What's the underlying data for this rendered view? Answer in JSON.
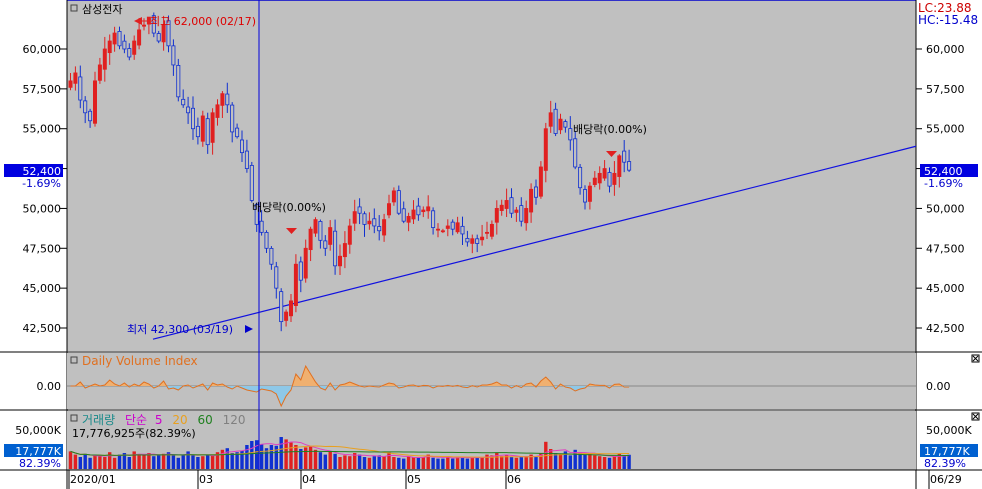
{
  "stock_name": "삼성전자",
  "indicators": {
    "lc": "LC:23.88",
    "hc": "HC:-15.48"
  },
  "current": {
    "price": "52,400",
    "change": "-1.69%"
  },
  "annotations": {
    "high": "최고 62,000 (02/17)",
    "low": "최저 42,300 (03/19)",
    "dividend1": "배당락(0.00%)",
    "dividend2": "배당락(0.00%)"
  },
  "volume_index_panel": {
    "title": "Daily Volume Index",
    "zero_left": "0.00",
    "zero_right": "0.00"
  },
  "volume_panel": {
    "title": "거래량",
    "ma_label": "단순",
    "ma_periods": [
      "5",
      "20",
      "60",
      "120"
    ],
    "ma_colors": [
      "#e040c0",
      "#e8a020",
      "#208020",
      "#808080"
    ],
    "last_volume": "17,776,925주(82.39%)",
    "axis_label": "50,000K",
    "value": "17,777K",
    "percent": "82.39%"
  },
  "x_axis_labels": [
    "2020/01",
    "03",
    "04",
    "05",
    "06",
    "06/29"
  ],
  "colors": {
    "up": "#e02020",
    "down": "#1030d0",
    "panel_bg": "#c0c0c0",
    "trendline": "#1010e0",
    "price_badge": "#0000e0"
  },
  "chart_data": {
    "type": "candlestick",
    "title": "삼성전자",
    "y_ticks": [
      42500,
      45000,
      47500,
      50000,
      52500,
      55000,
      57500,
      60000
    ],
    "y_tick_labels": [
      "42,500",
      "45,000",
      "47,500",
      "50,000",
      "52,500",
      "55,000",
      "57,500",
      "60,000"
    ],
    "ylim": [
      40800,
      63300
    ],
    "high": {
      "value": 62000,
      "date": "02/17"
    },
    "low": {
      "value": 42300,
      "date": "03/19"
    },
    "current_price": 52400,
    "change_pct": -1.69,
    "trendline": {
      "start": {
        "date": "03/19",
        "value": 42300
      },
      "end": {
        "date": "06/29",
        "value": 53900
      }
    },
    "closes": [
      58000,
      58500,
      56800,
      56000,
      55500,
      58000,
      59000,
      60000,
      60500,
      61000,
      60200,
      60000,
      59500,
      60500,
      61200,
      61500,
      62000,
      61000,
      60500,
      61500,
      60200,
      59000,
      57000,
      56500,
      56000,
      55000,
      54500,
      55800,
      54000,
      56000,
      56500,
      57200,
      56500,
      54800,
      54500,
      53500,
      52500,
      50500,
      49000,
      48500,
      47500,
      46500,
      45000,
      42900,
      43500,
      44200,
      46500,
      45500,
      47500,
      48700,
      49300,
      48000,
      47500,
      48800,
      46400,
      47000,
      47800,
      48900,
      49800,
      49700,
      49000,
      49200,
      48900,
      48600,
      49300,
      50300,
      51100,
      49700,
      49200,
      49500,
      49900,
      49600,
      49900,
      50100,
      48800,
      48700,
      48600,
      48900,
      48700,
      49100,
      48400,
      47900,
      48100,
      47800,
      48200,
      48500,
      49000,
      50000,
      50200,
      50500,
      49700,
      49900,
      49200,
      50000,
      51200,
      50700,
      52600,
      55000,
      56000,
      54700,
      55600,
      55100,
      54300,
      52600,
      51300,
      50400,
      51400,
      51900,
      52200,
      52500,
      51400,
      52200,
      53300,
      52900,
      52400
    ],
    "volume_index": [
      0,
      0,
      0.2,
      -0.1,
      0,
      0.1,
      0,
      0.05,
      0.3,
      0.1,
      0,
      0.15,
      -0.05,
      0.1,
      0,
      0.2,
      0.1,
      -0.1,
      0,
      0.25,
      -0.15,
      -0.1,
      -0.2,
      0,
      0.05,
      -0.1,
      0,
      0.1,
      -0.2,
      0.15,
      0.05,
      0.1,
      -0.05,
      -0.15,
      0,
      -0.1,
      -0.2,
      -0.25,
      -0.3,
      -0.15,
      -0.2,
      -0.25,
      -0.4,
      -1.0,
      -0.5,
      -0.2,
      0.6,
      0.3,
      1.0,
      0.6,
      0.2,
      -0.1,
      -0.2,
      0.15,
      -0.2,
      0.05,
      0.1,
      0.2,
      0.1,
      0,
      -0.05,
      0,
      -0.03,
      -0.05,
      0.05,
      0.15,
      0.1,
      -0.1,
      -0.05,
      0.03,
      0.05,
      -0.03,
      0.03,
      0.02,
      -0.1,
      0,
      -0.02,
      0.03,
      -0.02,
      0.03,
      -0.05,
      -0.08,
      0.02,
      -0.05,
      0.05,
      0.05,
      0.1,
      0.2,
      0.05,
      0.05,
      -0.1,
      0.02,
      -0.08,
      0.1,
      0.15,
      -0.05,
      0.25,
      0.45,
      0.2,
      -0.15,
      0.1,
      -0.05,
      -0.1,
      -0.25,
      -0.15,
      -0.1,
      0.1,
      0.05,
      0.03,
      0.03,
      -0.1,
      0.08,
      0.1,
      -0.05,
      -0.05
    ],
    "volume_k": [
      22000,
      18000,
      15000,
      19000,
      14000,
      17000,
      16000,
      15000,
      21000,
      14000,
      18000,
      20000,
      15000,
      22000,
      18000,
      17000,
      20000,
      16000,
      17000,
      19000,
      21000,
      17000,
      14000,
      18000,
      22000,
      17000,
      15000,
      16000,
      18000,
      17000,
      21000,
      24000,
      26000,
      20000,
      21000,
      23000,
      30000,
      35000,
      36000,
      31000,
      26000,
      30000,
      29000,
      40000,
      37000,
      33000,
      30000,
      25000,
      27000,
      28000,
      24000,
      21000,
      18000,
      22000,
      19000,
      15000,
      17000,
      16000,
      20000,
      18000,
      15000,
      14000,
      16000,
      17000,
      16000,
      21000,
      15000,
      14000,
      13000,
      16000,
      15000,
      14000,
      15000,
      18000,
      14000,
      13000,
      13000,
      16000,
      13000,
      15000,
      14000,
      13000,
      15000,
      14000,
      15000,
      18000,
      17000,
      20000,
      16000,
      17000,
      15000,
      14000,
      15000,
      16000,
      18000,
      16000,
      20000,
      34000,
      25000,
      20000,
      19000,
      22000,
      17000,
      24000,
      21000,
      18000,
      19000,
      17000,
      16000,
      15000,
      14000,
      16000,
      19000,
      17000,
      17777
    ]
  }
}
